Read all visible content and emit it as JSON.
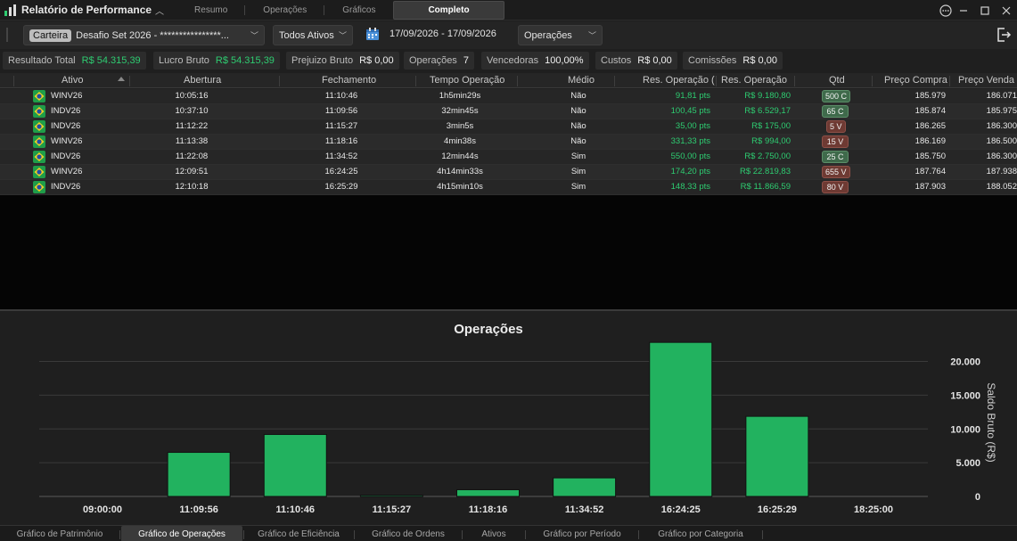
{
  "app": {
    "title": "Relatório de Performance",
    "tabs": [
      "Resumo",
      "Operações",
      "Gráficos",
      "Completo"
    ],
    "active_tab": "Completo"
  },
  "filters": {
    "portfolio_tag": "Carteira",
    "portfolio_value": "Desafio Set 2026 - ****************...",
    "assets": "Todos Ativos",
    "date_range": "17/09/2026 - 17/09/2026",
    "view": "Operações"
  },
  "summary": [
    {
      "label": "Resultado Total",
      "value": "R$ 54.315,39",
      "color": "#2ecc71"
    },
    {
      "label": "Lucro Bruto",
      "value": "R$ 54.315,39",
      "color": "#2ecc71"
    },
    {
      "label": "Prejuizo Bruto",
      "value": "R$ 0,00",
      "color": "#f0f0f0"
    },
    {
      "label": "Operações",
      "value": "7",
      "color": "#f0f0f0"
    },
    {
      "label": "Vencedoras",
      "value": "100,00%",
      "color": "#f0f0f0"
    },
    {
      "label": "Custos",
      "value": "R$ 0,00",
      "color": "#f0f0f0"
    },
    {
      "label": "Comissões",
      "value": "R$ 0,00",
      "color": "#f0f0f0"
    }
  ],
  "table": {
    "columns": [
      "Ativo",
      "Abertura",
      "Fechamento",
      "Tempo Operação",
      "Médio",
      "Res. Operação (",
      "Res. Operação",
      "Qtd",
      "Preço Compra",
      "Preço Venda"
    ],
    "rows": [
      {
        "ativo": "WINV26",
        "abertura": "10:05:16",
        "fechamento": "11:10:46",
        "tempo": "1h5min29s",
        "medio": "Não",
        "res_pts": "91,81 pts",
        "res_rs": "R$ 9.180,80",
        "qtd": "500 C",
        "side": "buy",
        "preco_compra": "185.979",
        "preco_venda": "186.071"
      },
      {
        "ativo": "INDV26",
        "abertura": "10:37:10",
        "fechamento": "11:09:56",
        "tempo": "32min45s",
        "medio": "Não",
        "res_pts": "100,45 pts",
        "res_rs": "R$ 6.529,17",
        "qtd": "65 C",
        "side": "buy",
        "preco_compra": "185.874",
        "preco_venda": "185.975"
      },
      {
        "ativo": "INDV26",
        "abertura": "11:12:22",
        "fechamento": "11:15:27",
        "tempo": "3min5s",
        "medio": "Não",
        "res_pts": "35,00 pts",
        "res_rs": "R$ 175,00",
        "qtd": "5 V",
        "side": "sell",
        "preco_compra": "186.265",
        "preco_venda": "186.300"
      },
      {
        "ativo": "WINV26",
        "abertura": "11:13:38",
        "fechamento": "11:18:16",
        "tempo": "4min38s",
        "medio": "Não",
        "res_pts": "331,33 pts",
        "res_rs": "R$ 994,00",
        "qtd": "15 V",
        "side": "sell",
        "preco_compra": "186.169",
        "preco_venda": "186.500"
      },
      {
        "ativo": "INDV26",
        "abertura": "11:22:08",
        "fechamento": "11:34:52",
        "tempo": "12min44s",
        "medio": "Sim",
        "res_pts": "550,00 pts",
        "res_rs": "R$ 2.750,00",
        "qtd": "25 C",
        "side": "buy",
        "preco_compra": "185.750",
        "preco_venda": "186.300"
      },
      {
        "ativo": "WINV26",
        "abertura": "12:09:51",
        "fechamento": "16:24:25",
        "tempo": "4h14min33s",
        "medio": "Sim",
        "res_pts": "174,20 pts",
        "res_rs": "R$ 22.819,83",
        "qtd": "655 V",
        "side": "sell",
        "preco_compra": "187.764",
        "preco_venda": "187.938"
      },
      {
        "ativo": "INDV26",
        "abertura": "12:10:18",
        "fechamento": "16:25:29",
        "tempo": "4h15min10s",
        "medio": "Sim",
        "res_pts": "148,33 pts",
        "res_rs": "R$ 11.866,59",
        "qtd": "80 V",
        "side": "sell",
        "preco_compra": "187.903",
        "preco_venda": "188.052"
      }
    ]
  },
  "chart_data": {
    "type": "bar",
    "title": "Operações",
    "xlabel": "",
    "ylabel": "Saldo Bruto (R$)",
    "categories": [
      "09:00:00",
      "11:09:56",
      "11:10:46",
      "11:15:27",
      "11:18:16",
      "11:34:52",
      "16:24:25",
      "16:25:29",
      "18:25:00"
    ],
    "values": [
      null,
      6529.17,
      9180.8,
      175.0,
      994.0,
      2750.0,
      22819.83,
      11866.59,
      null
    ],
    "yticks": [
      "0",
      "5.000",
      "10.000",
      "15.000",
      "20.000"
    ],
    "ylim": [
      0,
      23500
    ],
    "grid": true,
    "y_axis_position": "right",
    "bar_color": "#22b25f"
  },
  "bottom_tabs": {
    "items": [
      "Gráfico de Patrimônio",
      "Gráfico de Operações",
      "Gráfico de Eficiência",
      "Gráfico de Ordens",
      "Ativos",
      "Gráfico por Período",
      "Gráfico por Categoria"
    ],
    "active": "Gráfico de Operações"
  },
  "icons": {
    "app": "bar-chart-icon",
    "more": "more-options-icon",
    "minimize": "minimize-icon",
    "maximize": "maximize-icon",
    "close": "close-icon",
    "calendar": "calendar-icon",
    "exit": "exit-icon",
    "flag": "brazil-flag-icon"
  }
}
